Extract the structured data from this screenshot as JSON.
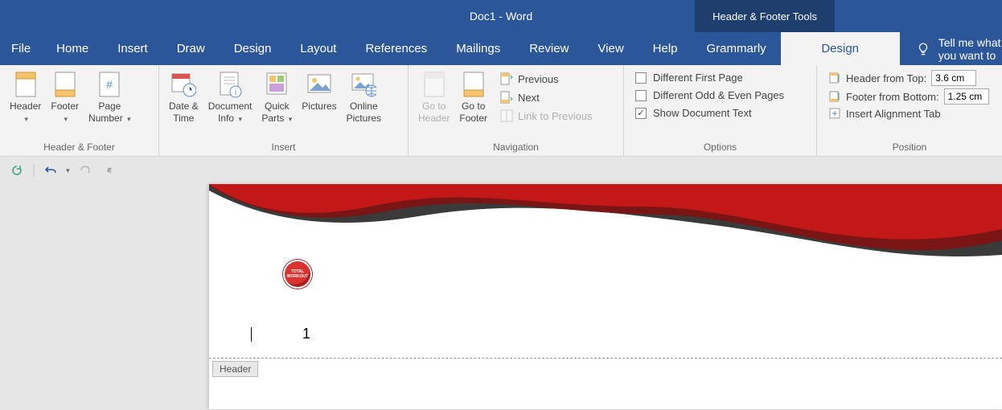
{
  "title": "Doc1  -  Word",
  "contextual_tab_title": "Header & Footer Tools",
  "tabs": {
    "file": "File",
    "home": "Home",
    "insert": "Insert",
    "draw": "Draw",
    "design": "Design",
    "layout": "Layout",
    "references": "References",
    "mailings": "Mailings",
    "review": "Review",
    "view": "View",
    "help": "Help",
    "grammarly": "Grammarly",
    "hf_design": "Design"
  },
  "tell_me": "Tell me what you want to",
  "groups": {
    "header_footer": {
      "label": "Header & Footer",
      "header": "Header",
      "footer": "Footer",
      "page_number_l1": "Page",
      "page_number_l2": "Number"
    },
    "insert": {
      "label": "Insert",
      "date_time_l1": "Date &",
      "date_time_l2": "Time",
      "doc_info_l1": "Document",
      "doc_info_l2": "Info",
      "quick_parts_l1": "Quick",
      "quick_parts_l2": "Parts",
      "pictures": "Pictures",
      "online_pics_l1": "Online",
      "online_pics_l2": "Pictures"
    },
    "navigation": {
      "label": "Navigation",
      "goto_header_l1": "Go to",
      "goto_header_l2": "Header",
      "goto_footer_l1": "Go to",
      "goto_footer_l2": "Footer",
      "previous": "Previous",
      "next": "Next",
      "link_previous": "Link to Previous"
    },
    "options": {
      "label": "Options",
      "diff_first": "Different First Page",
      "diff_odd_even": "Different Odd & Even Pages",
      "show_doc_text": "Show Document Text",
      "show_doc_text_checked": true
    },
    "position": {
      "label": "Position",
      "header_top": "Header from Top:",
      "header_top_val": "3.6 cm",
      "footer_bottom": "Footer from Bottom:",
      "footer_bottom_val": "1.25 cm",
      "align_tab": "Insert Alignment Tab"
    }
  },
  "doc": {
    "page_number": "1",
    "header_indicator": "Header",
    "logo_text": "TOTAL WORKOUT"
  }
}
